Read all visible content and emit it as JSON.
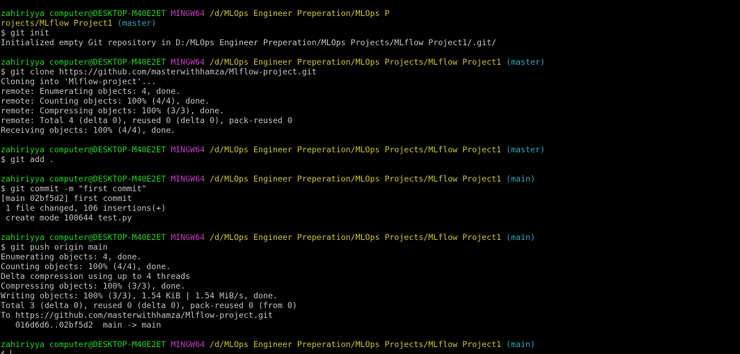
{
  "colors": {
    "background": "#000000",
    "text": "#c0c0c0",
    "user": "#23d123",
    "msystem": "#c13cc1",
    "path": "#c6c22b",
    "branch": "#2aa6bf"
  },
  "terminal": {
    "lines": [
      {
        "type": "prompt",
        "user": "zahiriyya computer@DESKTOP-M40E2ET",
        "msystem": "MINGW64",
        "path": "/d/MLOps Engineer Preperation/MLOps P",
        "branch": ""
      },
      {
        "type": "prompt-wrap",
        "path": "rojects/MLflow Project1",
        "branch": "(master)"
      },
      {
        "type": "command",
        "text": "$ git init"
      },
      {
        "type": "output",
        "text": "Initialized empty Git repository in D:/MLOps Engineer Preperation/MLOps Projects/MLflow Project1/.git/"
      },
      {
        "type": "blank"
      },
      {
        "type": "prompt",
        "user": "zahiriyya computer@DESKTOP-M40E2ET",
        "msystem": "MINGW64",
        "path": "/d/MLOps Engineer Preperation/MLOps Projects/MLflow Project1",
        "branch": "(master)"
      },
      {
        "type": "command",
        "text": "$ git clone https://github.com/masterwithhamza/Mlflow-project.git"
      },
      {
        "type": "output",
        "text": "Cloning into 'Mlflow-project'..."
      },
      {
        "type": "output",
        "text": "remote: Enumerating objects: 4, done."
      },
      {
        "type": "output",
        "text": "remote: Counting objects: 100% (4/4), done."
      },
      {
        "type": "output",
        "text": "remote: Compressing objects: 100% (3/3), done."
      },
      {
        "type": "output",
        "text": "remote: Total 4 (delta 0), reused 0 (delta 0), pack-reused 0"
      },
      {
        "type": "output",
        "text": "Receiving objects: 100% (4/4), done."
      },
      {
        "type": "blank"
      },
      {
        "type": "prompt",
        "user": "zahiriyya computer@DESKTOP-M40E2ET",
        "msystem": "MINGW64",
        "path": "/d/MLOps Engineer Preperation/MLOps Projects/MLflow Project1",
        "branch": "(master)"
      },
      {
        "type": "command",
        "text": "$ git add ."
      },
      {
        "type": "blank"
      },
      {
        "type": "prompt",
        "user": "zahiriyya computer@DESKTOP-M40E2ET",
        "msystem": "MINGW64",
        "path": "/d/MLOps Engineer Preperation/MLOps Projects/MLflow Project1",
        "branch": "(main)"
      },
      {
        "type": "command",
        "text": "$ git commit -m \"first commit\""
      },
      {
        "type": "output",
        "text": "[main 02bf5d2] first commit"
      },
      {
        "type": "output",
        "text": " 1 file changed, 106 insertions(+)"
      },
      {
        "type": "output",
        "text": " create mode 100644 test.py"
      },
      {
        "type": "blank"
      },
      {
        "type": "prompt",
        "user": "zahiriyya computer@DESKTOP-M40E2ET",
        "msystem": "MINGW64",
        "path": "/d/MLOps Engineer Preperation/MLOps Projects/MLflow Project1",
        "branch": "(main)"
      },
      {
        "type": "command",
        "text": "$ git push origin main"
      },
      {
        "type": "output",
        "text": "Enumerating objects: 4, done."
      },
      {
        "type": "output",
        "text": "Counting objects: 100% (4/4), done."
      },
      {
        "type": "output",
        "text": "Delta compression using up to 4 threads"
      },
      {
        "type": "output",
        "text": "Compressing objects: 100% (3/3), done."
      },
      {
        "type": "output",
        "text": "Writing objects: 100% (3/3), 1.54 KiB | 1.54 MiB/s, done."
      },
      {
        "type": "output",
        "text": "Total 3 (delta 0), reused 0 (delta 0), pack-reused 0 (from 0)"
      },
      {
        "type": "output",
        "text": "To https://github.com/masterwithhamza/Mlflow-project.git"
      },
      {
        "type": "output",
        "text": "   016d6d6..02bf5d2  main -> main"
      },
      {
        "type": "blank"
      },
      {
        "type": "prompt",
        "user": "zahiriyya computer@DESKTOP-M40E2ET",
        "msystem": "MINGW64",
        "path": "/d/MLOps Engineer Preperation/MLOps Projects/MLflow Project1",
        "branch": "(main)"
      },
      {
        "type": "input",
        "text": "$ "
      }
    ]
  }
}
